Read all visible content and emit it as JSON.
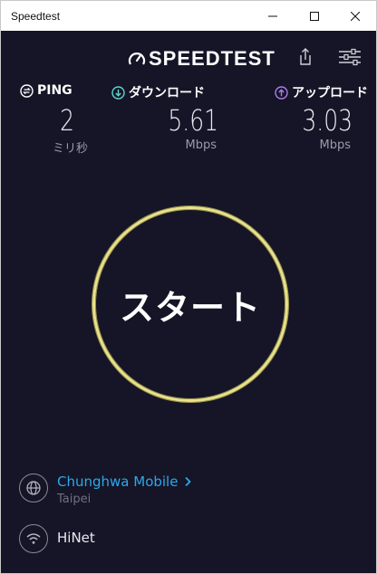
{
  "window": {
    "title": "Speedtest"
  },
  "header": {
    "logo_text": "SPEEDTEST",
    "share_icon": "share-icon",
    "settings_icon": "settings-icon"
  },
  "metrics": {
    "ping": {
      "label": "PING",
      "value": "2",
      "unit": "ミリ秒"
    },
    "download": {
      "label": "ダウンロード",
      "value": "5.61",
      "unit": "Mbps"
    },
    "upload": {
      "label": "アップロード",
      "value": "3.03",
      "unit": "Mbps"
    }
  },
  "start_button": {
    "label": "スタート"
  },
  "provider": {
    "name": "Chunghwa Mobile",
    "location": "Taipei"
  },
  "network": {
    "name": "HiNet"
  },
  "colors": {
    "background": "#151527",
    "accent_ring": "#e9e28a",
    "download_icon": "#5fd5d0",
    "upload_icon": "#b07ce8",
    "provider_link": "#2ea8e8"
  }
}
